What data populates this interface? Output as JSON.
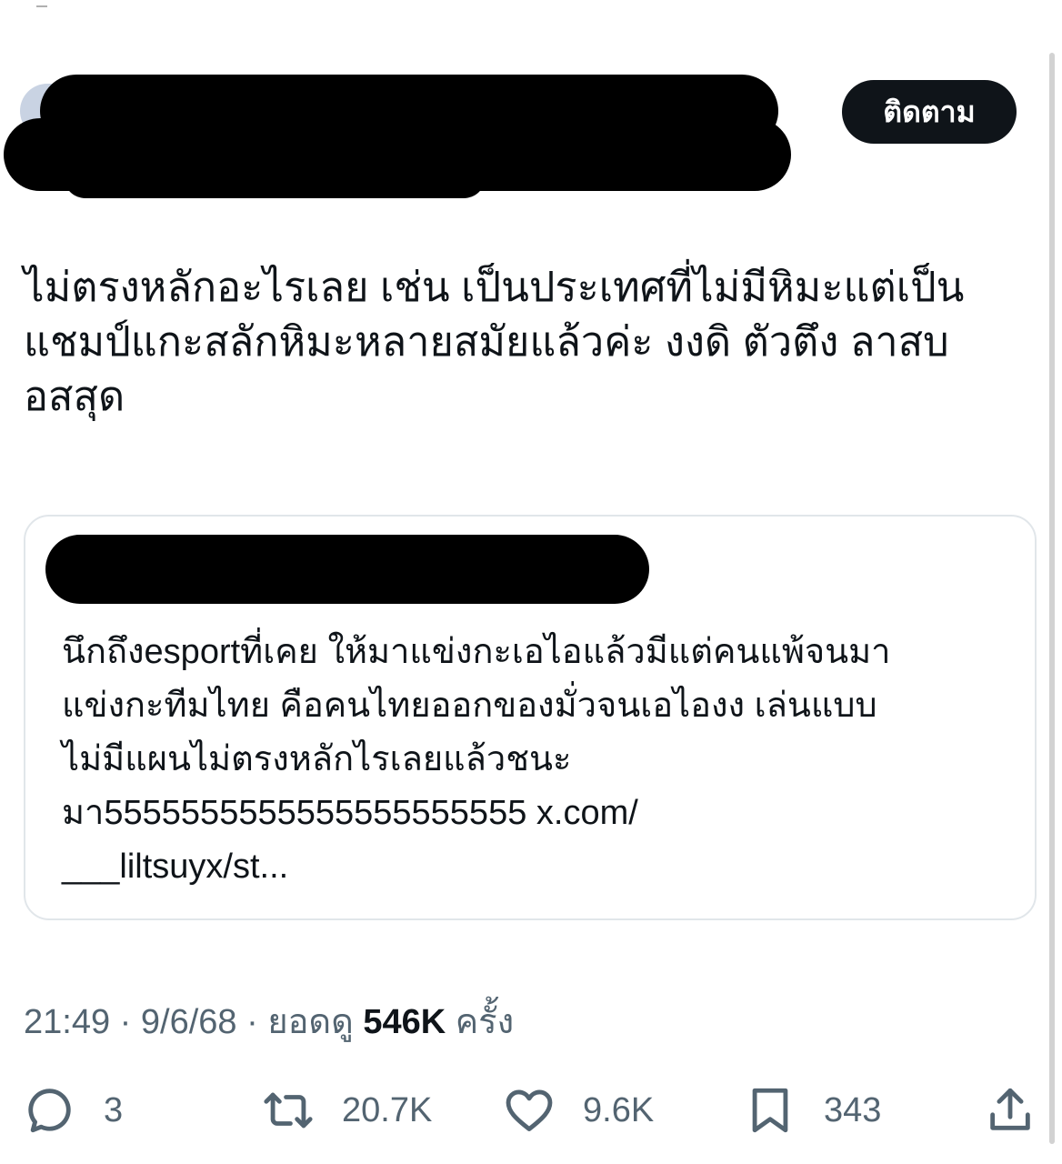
{
  "follow_button": {
    "label": "ติดตาม"
  },
  "post": {
    "text": "ไม่ตรงหลักอะไรเลย เช่น เป็นประเทศที่ไม่มีหิมะแต่เป็น\nแชมป์แกะสลักหิมะหลายสมัยแล้วค่ะ งงดิ ตัวตึง ลาสบ\nอสสุด"
  },
  "quoted_post": {
    "text": "นึกถึงesportที่เคย ให้มาแข่งกะเอไอแล้วมีแต่คนแพ้จนมา\nแข่งกะทีมไทย คือคนไทยออกของมั่วจนเอไองง เล่นแบบ\nไม่มีแผนไม่ตรงหลักไรเลยแล้วชนะ\nมา5555555555555555555555 x.com/\n___liltsuyx/st..."
  },
  "meta": {
    "time": "21:49",
    "separator": " · ",
    "date": "9/6/68",
    "views_label": "ยอดดู",
    "views_count": "546K",
    "views_suffix": "ครั้ง"
  },
  "actions": {
    "replies": "3",
    "reposts": "20.7K",
    "likes": "9.6K",
    "bookmarks": "343"
  },
  "icons": {
    "reply": "reply-icon",
    "repost": "repost-icon",
    "like": "heart-icon",
    "bookmark": "bookmark-icon",
    "share": "share-icon"
  },
  "colors": {
    "text": "#0f1419",
    "secondary": "#536471",
    "border": "#e1e6ea",
    "follow_bg": "#0f1419"
  }
}
